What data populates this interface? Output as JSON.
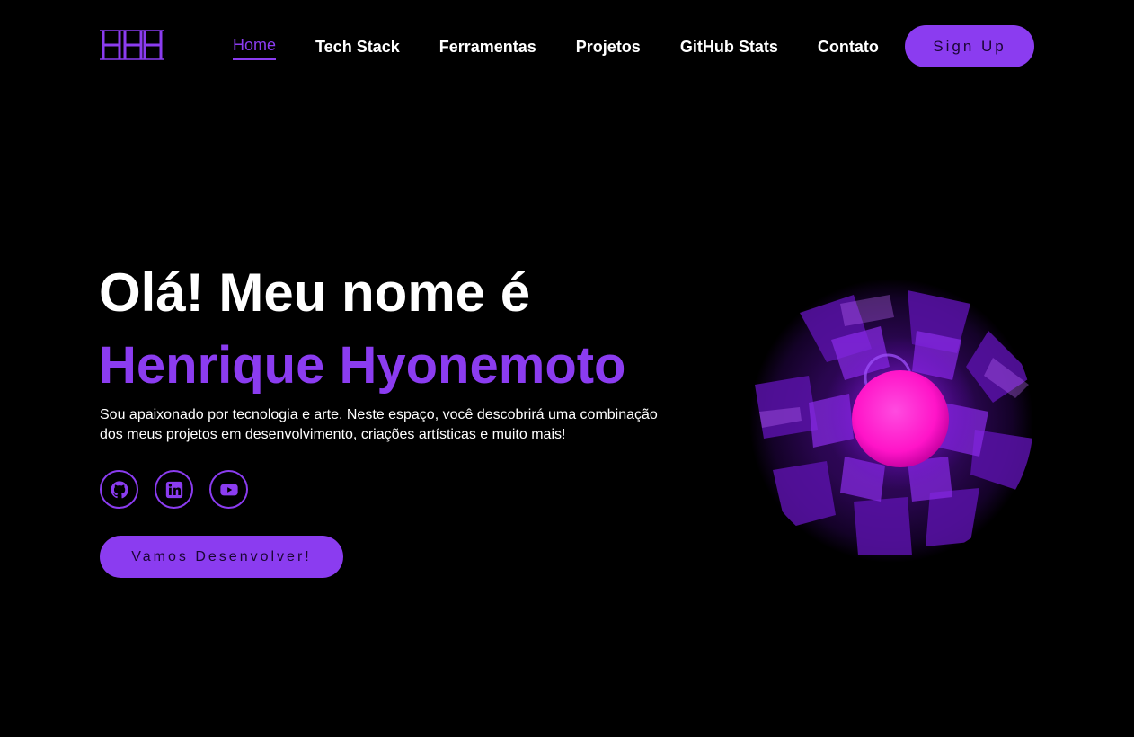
{
  "logo": {
    "text": "HHH",
    "icon": "monogram-logo"
  },
  "nav": {
    "items": [
      {
        "label": "Home",
        "active": true
      },
      {
        "label": "Tech Stack",
        "active": false
      },
      {
        "label": "Ferramentas",
        "active": false
      },
      {
        "label": "Projetos",
        "active": false
      },
      {
        "label": "GitHub Stats",
        "active": false
      },
      {
        "label": "Contato",
        "active": false
      }
    ],
    "signup_label": "Sign Up"
  },
  "hero": {
    "greeting": "Olá! Meu nome é",
    "name": "Henrique Hyonemoto",
    "description": "Sou apaixonado por tecnologia e arte. Neste espaço, você descobrirá uma combinação dos meus projetos em desenvolvimento, criações artísticas e muito mais!",
    "socials": [
      {
        "icon": "github-icon"
      },
      {
        "icon": "linkedin-icon"
      },
      {
        "icon": "youtube-icon"
      }
    ],
    "cta_label": "Vamos Desenvolver!"
  },
  "colors": {
    "accent": "#8b3cf0",
    "background": "#000000",
    "orb_core": "#ff14c8"
  }
}
